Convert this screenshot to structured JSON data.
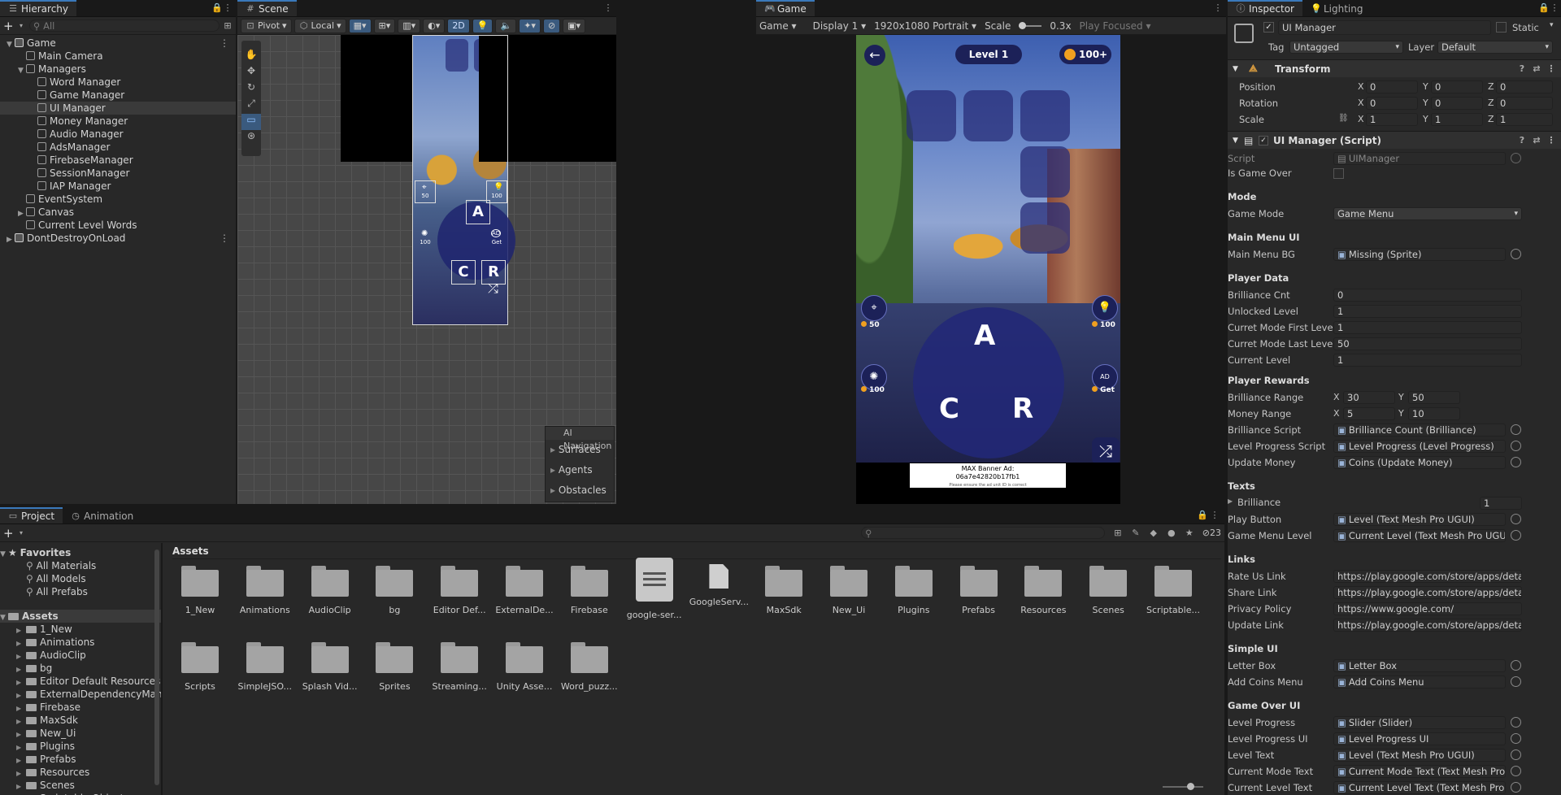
{
  "hierarchy": {
    "tab": "Hierarchy",
    "search_placeholder": "All",
    "items": [
      {
        "label": "Game",
        "depth": 0,
        "expanded": "open",
        "kind": "scene"
      },
      {
        "label": "Main Camera",
        "depth": 1,
        "expanded": "none",
        "kind": "obj"
      },
      {
        "label": "Managers",
        "depth": 1,
        "expanded": "open",
        "kind": "obj"
      },
      {
        "label": "Word Manager",
        "depth": 2,
        "expanded": "none",
        "kind": "obj"
      },
      {
        "label": "Game Manager",
        "depth": 2,
        "expanded": "none",
        "kind": "obj"
      },
      {
        "label": "UI Manager",
        "depth": 2,
        "expanded": "none",
        "kind": "obj",
        "selected": true
      },
      {
        "label": "Money Manager",
        "depth": 2,
        "expanded": "none",
        "kind": "obj"
      },
      {
        "label": "Audio Manager",
        "depth": 2,
        "expanded": "none",
        "kind": "obj"
      },
      {
        "label": "AdsManager",
        "depth": 2,
        "expanded": "none",
        "kind": "obj"
      },
      {
        "label": "FirebaseManager",
        "depth": 2,
        "expanded": "none",
        "kind": "obj"
      },
      {
        "label": "SessionManager",
        "depth": 2,
        "expanded": "none",
        "kind": "obj"
      },
      {
        "label": "IAP Manager",
        "depth": 2,
        "expanded": "none",
        "kind": "obj"
      },
      {
        "label": "EventSystem",
        "depth": 1,
        "expanded": "none",
        "kind": "obj"
      },
      {
        "label": "Canvas",
        "depth": 1,
        "expanded": "closed",
        "kind": "obj"
      },
      {
        "label": "Current Level Words",
        "depth": 1,
        "expanded": "none",
        "kind": "obj"
      },
      {
        "label": "DontDestroyOnLoad",
        "depth": 0,
        "expanded": "closed",
        "kind": "scene"
      }
    ]
  },
  "scene": {
    "tab": "Scene",
    "pivot": "Pivot",
    "local": "Local",
    "mode2d": "2D",
    "nav_title": "AI Navigation",
    "nav_items": [
      "Surfaces",
      "Agents",
      "Obstacles"
    ],
    "letters": [
      "A",
      "C",
      "R"
    ],
    "left_top_cost": "50",
    "right_top_cost": "100",
    "left_bot_cost": "100",
    "right_bot_label": "Get"
  },
  "game": {
    "tab": "Game",
    "view": "Game",
    "display": "Display 1",
    "resolution": "1920x1080 Portrait",
    "scale_label": "Scale",
    "scale_value": "0.3x",
    "play_focused": "Play Focused",
    "level": "Level 1",
    "coins": "100+",
    "letters": [
      "A",
      "C",
      "R"
    ],
    "hint_left_top": "50",
    "hint_right_top": "100",
    "hint_left_bot": "100",
    "hint_right_bot": "Get",
    "ad_label": "AD",
    "banner_title": "MAX Banner Ad:",
    "banner_id": "06a7e42820b17fb1",
    "banner_note": "Please ensure the ad unit ID is correct"
  },
  "inspector": {
    "tab": "Inspector",
    "tab2": "Lighting",
    "object_name": "UI Manager",
    "static_label": "Static",
    "tag_label": "Tag",
    "tag_value": "Untagged",
    "layer_label": "Layer",
    "layer_value": "Default",
    "transform": {
      "title": "Transform",
      "rows": [
        {
          "label": "Position",
          "x": "0",
          "y": "0",
          "z": "0"
        },
        {
          "label": "Rotation",
          "x": "0",
          "y": "0",
          "z": "0"
        },
        {
          "label": "Scale",
          "x": "1",
          "y": "1",
          "z": "1"
        }
      ]
    },
    "script_title": "UI Manager (Script)",
    "script_label": "Script",
    "script_value": "UIManager",
    "is_game_over": "Is Game Over",
    "sections": {
      "mode": "Mode",
      "main_menu": "Main Menu UI",
      "player_data": "Player Data",
      "player_rewards": "Player Rewards",
      "texts": "Texts",
      "links": "Links",
      "simple_ui": "Simple UI",
      "game_over": "Game Over UI"
    },
    "game_mode_label": "Game Mode",
    "game_mode_value": "Game Menu",
    "main_menu_bg_label": "Main Menu BG",
    "main_menu_bg_value": "Missing (Sprite)",
    "player_data": [
      {
        "label": "Brilliance Cnt",
        "value": "0"
      },
      {
        "label": "Unlocked Level",
        "value": "1"
      },
      {
        "label": "Curret Mode First Level",
        "value": "1"
      },
      {
        "label": "Curret Mode Last Level",
        "value": "50"
      },
      {
        "label": "Current Level",
        "value": "1"
      }
    ],
    "brilliance_range": {
      "label": "Brilliance Range",
      "x": "30",
      "y": "50"
    },
    "money_range": {
      "label": "Money Range",
      "x": "5",
      "y": "10"
    },
    "rewards_refs": [
      {
        "label": "Brilliance Script",
        "value": "Brilliance Count (Brilliance)"
      },
      {
        "label": "Level Progress Script",
        "value": "Level Progress (Level Progress)"
      },
      {
        "label": "Update Money",
        "value": "Coins (Update Money)"
      }
    ],
    "texts_brilliance": {
      "label": "Brilliance",
      "value": "1"
    },
    "texts_refs": [
      {
        "label": "Play Button",
        "value": "Level (Text Mesh Pro UGUI)"
      },
      {
        "label": "Game Menu Level",
        "value": "Current Level (Text Mesh Pro UGUI)"
      }
    ],
    "links": [
      {
        "label": "Rate Us Link",
        "value": "https://play.google.com/store/apps/details"
      },
      {
        "label": "Share Link",
        "value": "https://play.google.com/store/apps/details"
      },
      {
        "label": "Privacy Policy",
        "value": "https://www.google.com/"
      },
      {
        "label": "Update Link",
        "value": "https://play.google.com/store/apps/details"
      }
    ],
    "simple_ui": [
      {
        "label": "Letter Box",
        "value": "Letter Box"
      },
      {
        "label": "Add Coins Menu",
        "value": "Add Coins Menu"
      }
    ],
    "game_over": [
      {
        "label": "Level Progress",
        "value": "Slider (Slider)"
      },
      {
        "label": "Level Progress UI",
        "value": "Level Progress UI"
      },
      {
        "label": "Level Text",
        "value": "Level (Text Mesh Pro UGUI)"
      },
      {
        "label": "Current Mode Text",
        "value": "Current Mode Text (Text Mesh Pro UGUI)"
      },
      {
        "label": "Current Level Text",
        "value": "Current Level Text (Text Mesh Pro UGUI)"
      }
    ]
  },
  "project": {
    "tab": "Project",
    "tab2": "Animation",
    "hidden_count": "23",
    "breadcrumb": "Assets",
    "favorites_label": "Favorites",
    "favorites": [
      "All Materials",
      "All Models",
      "All Prefabs"
    ],
    "assets_label": "Assets",
    "tree": [
      "1_New",
      "Animations",
      "AudioClip",
      "bg",
      "Editor Default Resources",
      "ExternalDependencyManager",
      "Firebase",
      "MaxSdk",
      "New_Ui",
      "Plugins",
      "Prefabs",
      "Resources",
      "Scenes",
      "Scriptable Objects"
    ],
    "assets": [
      {
        "label": "1_New",
        "kind": "folder"
      },
      {
        "label": "Animations",
        "kind": "folder"
      },
      {
        "label": "AudioClip",
        "kind": "folder"
      },
      {
        "label": "bg",
        "kind": "folder"
      },
      {
        "label": "Editor Def...",
        "kind": "folder"
      },
      {
        "label": "ExternalDe...",
        "kind": "folder"
      },
      {
        "label": "Firebase",
        "kind": "folder"
      },
      {
        "label": "google-ser...",
        "kind": "doc"
      },
      {
        "label": "GoogleServ...",
        "kind": "file"
      },
      {
        "label": "MaxSdk",
        "kind": "folder"
      },
      {
        "label": "New_Ui",
        "kind": "folder"
      },
      {
        "label": "Plugins",
        "kind": "folder"
      },
      {
        "label": "Prefabs",
        "kind": "folder"
      },
      {
        "label": "Resources",
        "kind": "folder"
      },
      {
        "label": "Scenes",
        "kind": "folder"
      },
      {
        "label": "Scriptable...",
        "kind": "folder"
      },
      {
        "label": "Scripts",
        "kind": "folder"
      },
      {
        "label": "SimpleJSO...",
        "kind": "folder"
      },
      {
        "label": "Splash Vid...",
        "kind": "folder"
      },
      {
        "label": "Sprites",
        "kind": "folder"
      },
      {
        "label": "Streaming...",
        "kind": "folder"
      },
      {
        "label": "Unity Asse...",
        "kind": "folder"
      },
      {
        "label": "Word_puzz...",
        "kind": "folder"
      }
    ]
  }
}
